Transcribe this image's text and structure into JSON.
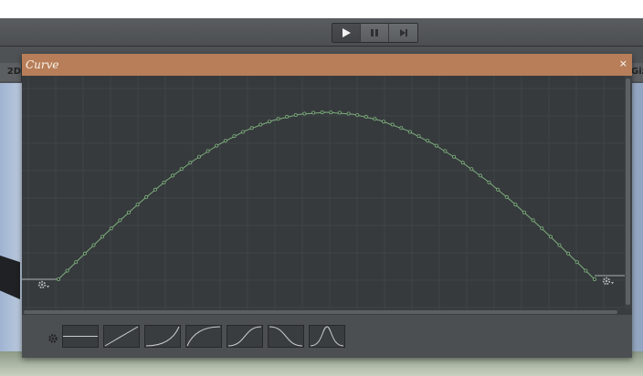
{
  "toolbar": {
    "play_icon": "play-icon",
    "pause_icon": "pause-icon",
    "step_icon": "step-icon"
  },
  "scene": {
    "left_tab_text": "2D",
    "right_tab_text": "Giz"
  },
  "curve_window": {
    "title": "Curve",
    "close_label": "×",
    "key_left_icon": "gear-icon",
    "key_right_icon": "gear-icon"
  },
  "chart_data": {
    "type": "line",
    "shape": "sine-arc",
    "x": [
      0.0,
      0.05,
      0.1,
      0.15,
      0.2,
      0.25,
      0.3,
      0.35,
      0.4,
      0.45,
      0.5,
      0.55,
      0.6,
      0.65,
      0.7,
      0.75,
      0.8,
      0.85,
      0.9,
      0.95,
      1.0
    ],
    "y": [
      0.0,
      0.156,
      0.309,
      0.454,
      0.588,
      0.707,
      0.809,
      0.891,
      0.951,
      0.988,
      1.0,
      0.988,
      0.951,
      0.891,
      0.809,
      0.707,
      0.588,
      0.454,
      0.309,
      0.156,
      0.0
    ],
    "point_count": 62,
    "curve_color": "#7fb07d",
    "background": "#363a3d",
    "grid": true
  },
  "presets": {
    "settings_icon": "gear-icon",
    "items": [
      {
        "name": "constant"
      },
      {
        "name": "linear"
      },
      {
        "name": "ease-in"
      },
      {
        "name": "ease-out"
      },
      {
        "name": "ease-in-out"
      },
      {
        "name": "ease-down"
      },
      {
        "name": "bell"
      }
    ]
  }
}
